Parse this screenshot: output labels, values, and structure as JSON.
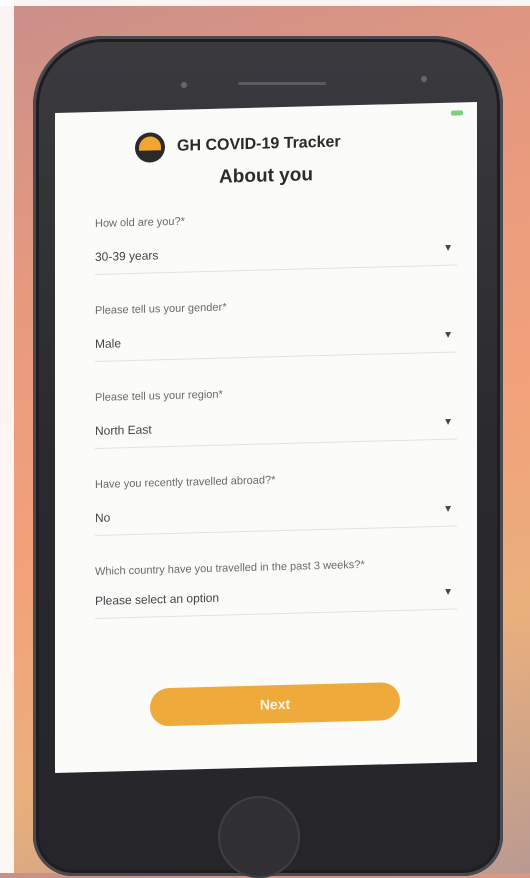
{
  "app": {
    "brand_name": "GH COVID-19 Tracker"
  },
  "page": {
    "title": "About you"
  },
  "form": {
    "fields": [
      {
        "label": "How old are you?*",
        "value": "30-39 years"
      },
      {
        "label": "Please tell us your gender*",
        "value": "Male"
      },
      {
        "label": "Please tell us your region*",
        "value": "North East"
      },
      {
        "label": "Have you recently travelled abroad?*",
        "value": "No"
      },
      {
        "label": "Which country have you travelled in the past 3 weeks?*",
        "value": "Please select an option"
      }
    ],
    "next_label": "Next"
  },
  "colors": {
    "accent": "#eeab3c",
    "screen_bg": "#fbfbfa"
  }
}
